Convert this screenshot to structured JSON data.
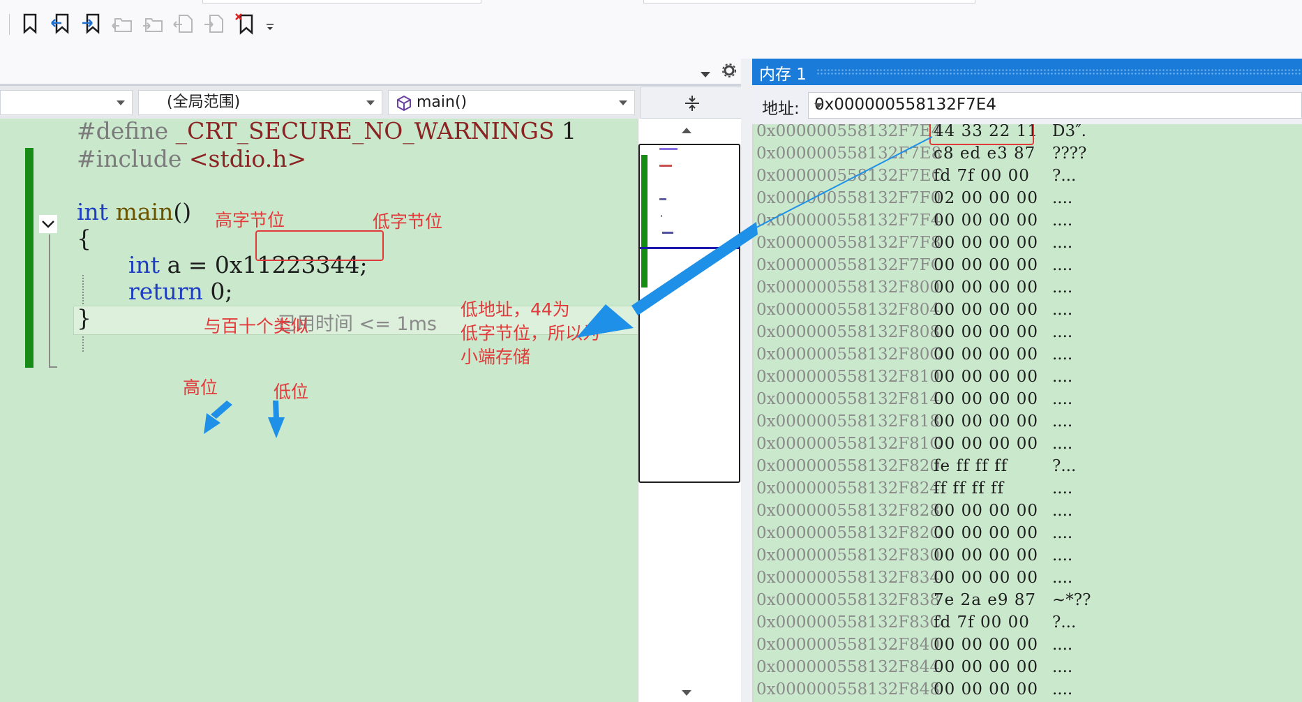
{
  "toolbar": {
    "buttons": [
      "bookmark-toggle-icon",
      "bookmark-prev-icon",
      "bookmark-next-icon",
      "bookmark-prev-folder-icon",
      "bookmark-next-folder-icon",
      "bookmark-prev-doc-icon",
      "bookmark-next-doc-icon",
      "bookmark-clear-icon"
    ]
  },
  "editor_header": {
    "scope": "(全局范围)",
    "function": "main()"
  },
  "code": {
    "line1_directive": "#define",
    "line1_macro": "_CRT_SECURE_NO_WARNINGS",
    "line1_value": "1",
    "line2_directive": "#include",
    "line2_header": "<stdio.h>",
    "line3_type": "int",
    "line3_name": "main",
    "line3_parens": "()",
    "line4_brace": "{",
    "line5_type": "int",
    "line5_rest": "a = 0x",
    "line5_value": "11223344;",
    "line6_kw": "return",
    "line6_rest": "0;",
    "line6_elapsed": "已用时间 <= 1ms",
    "line7_brace": "}"
  },
  "annotations": {
    "high_byte": "高字节位",
    "low_byte": "低字节位",
    "analogy": "与百十个类似",
    "high": "高位",
    "low": "低位",
    "explain_1": "低地址，44为",
    "explain_2": "低字节位，所以为",
    "explain_3": "小端存储"
  },
  "memory": {
    "title": "内存 1",
    "address_label": "地址:",
    "address_value": "0x000000558132F7E4",
    "rows": [
      {
        "addr": "0x000000558132F7E4",
        "hex": "44 33 22 11",
        "chars": "D3″."
      },
      {
        "addr": "0x000000558132F7E8",
        "hex": "c8 ed e3 87",
        "chars": "????"
      },
      {
        "addr": "0x000000558132F7EC",
        "hex": "fd 7f 00 00",
        "chars": "?..."
      },
      {
        "addr": "0x000000558132F7F0",
        "hex": "02 00 00 00",
        "chars": "...."
      },
      {
        "addr": "0x000000558132F7F4",
        "hex": "00 00 00 00",
        "chars": "...."
      },
      {
        "addr": "0x000000558132F7F8",
        "hex": "00 00 00 00",
        "chars": "...."
      },
      {
        "addr": "0x000000558132F7FC",
        "hex": "00 00 00 00",
        "chars": "...."
      },
      {
        "addr": "0x000000558132F800",
        "hex": "00 00 00 00",
        "chars": "...."
      },
      {
        "addr": "0x000000558132F804",
        "hex": "00 00 00 00",
        "chars": "...."
      },
      {
        "addr": "0x000000558132F808",
        "hex": "00 00 00 00",
        "chars": "...."
      },
      {
        "addr": "0x000000558132F80C",
        "hex": "00 00 00 00",
        "chars": "...."
      },
      {
        "addr": "0x000000558132F810",
        "hex": "00 00 00 00",
        "chars": "...."
      },
      {
        "addr": "0x000000558132F814",
        "hex": "00 00 00 00",
        "chars": "...."
      },
      {
        "addr": "0x000000558132F818",
        "hex": "00 00 00 00",
        "chars": "...."
      },
      {
        "addr": "0x000000558132F81C",
        "hex": "00 00 00 00",
        "chars": "...."
      },
      {
        "addr": "0x000000558132F820",
        "hex": "fe ff ff ff",
        "chars": "?..."
      },
      {
        "addr": "0x000000558132F824",
        "hex": "ff ff ff ff",
        "chars": "...."
      },
      {
        "addr": "0x000000558132F828",
        "hex": "00 00 00 00",
        "chars": "...."
      },
      {
        "addr": "0x000000558132F82C",
        "hex": "00 00 00 00",
        "chars": "...."
      },
      {
        "addr": "0x000000558132F830",
        "hex": "00 00 00 00",
        "chars": "...."
      },
      {
        "addr": "0x000000558132F834",
        "hex": "00 00 00 00",
        "chars": "...."
      },
      {
        "addr": "0x000000558132F838",
        "hex": "7e 2a e9 87",
        "chars": "~*??"
      },
      {
        "addr": "0x000000558132F83C",
        "hex": "fd 7f 00 00",
        "chars": "?..."
      },
      {
        "addr": "0x000000558132F840",
        "hex": "00 00 00 00",
        "chars": "...."
      },
      {
        "addr": "0x000000558132F844",
        "hex": "00 00 00 00",
        "chars": "...."
      },
      {
        "addr": "0x000000558132F848",
        "hex": "00 00 00 00",
        "chars": "...."
      }
    ]
  },
  "colors": {
    "editor_bg": "#c9e8cc",
    "accent_blue": "#1a7cd8",
    "annotation_red": "#e23a3a",
    "arrow_blue": "#1e90e8",
    "change_bar_green": "#168c16"
  }
}
